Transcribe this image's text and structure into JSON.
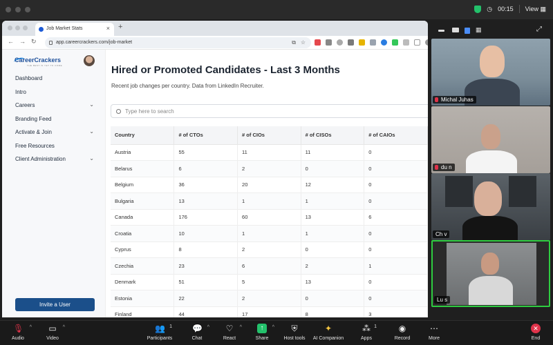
{
  "meeting": {
    "timer": "00:15",
    "view_label": "View"
  },
  "browser": {
    "tab_title": "Job Market Stats",
    "url": "app.careercrackers.com/job-market"
  },
  "sidebar": {
    "logo_text": "CareerCrackers",
    "logo_tagline": "THE BEST IS YET TO COME",
    "items": [
      {
        "label": "Dashboard"
      },
      {
        "label": "Intro"
      },
      {
        "label": "Careers"
      },
      {
        "label": "Branding Feed"
      },
      {
        "label": "Activate & Join"
      },
      {
        "label": "Free Resources"
      },
      {
        "label": "Client Administration"
      }
    ],
    "invite_label": "Invite a User"
  },
  "main": {
    "title": "Hired or Promoted Candidates - Last 3 Months",
    "subtitle": "Recent job changes per country. Data from LinkedIn Recruiter.",
    "search_placeholder": "Type here to search",
    "table": {
      "headers": [
        "Country",
        "# of CTOs",
        "# of CIOs",
        "# of CISOs",
        "# of CAIOs"
      ],
      "rows": [
        [
          "Austria",
          "55",
          "11",
          "11",
          "0"
        ],
        [
          "Belarus",
          "6",
          "2",
          "0",
          "0"
        ],
        [
          "Belgium",
          "36",
          "20",
          "12",
          "0"
        ],
        [
          "Bulgaria",
          "13",
          "1",
          "1",
          "0"
        ],
        [
          "Canada",
          "176",
          "60",
          "13",
          "6"
        ],
        [
          "Croatia",
          "10",
          "1",
          "1",
          "0"
        ],
        [
          "Cyprus",
          "8",
          "2",
          "0",
          "0"
        ],
        [
          "Czechia",
          "23",
          "6",
          "2",
          "1"
        ],
        [
          "Denmark",
          "51",
          "5",
          "13",
          "0"
        ],
        [
          "Estonia",
          "22",
          "2",
          "0",
          "0"
        ],
        [
          "Finland",
          "44",
          "17",
          "8",
          "3"
        ]
      ]
    }
  },
  "participants": [
    {
      "name": "Michal Juhas"
    },
    {
      "name": "du  n"
    },
    {
      "name": "Ch                          v"
    },
    {
      "name": "Lu            s"
    }
  ],
  "toolbar": {
    "buttons": [
      {
        "label": "Audio",
        "icon": "mic-muted-icon"
      },
      {
        "label": "Video",
        "icon": "video-icon"
      },
      {
        "label": "Participants",
        "icon": "participants-icon",
        "count": "1"
      },
      {
        "label": "Chat",
        "icon": "chat-icon"
      },
      {
        "label": "React",
        "icon": "heart-icon"
      },
      {
        "label": "Share",
        "icon": "share-icon"
      },
      {
        "label": "Host tools",
        "icon": "shield-icon"
      },
      {
        "label": "AI Companion",
        "icon": "sparkle-icon"
      },
      {
        "label": "Apps",
        "icon": "apps-icon",
        "count": "1"
      },
      {
        "label": "Record",
        "icon": "record-icon"
      },
      {
        "label": "More",
        "icon": "more-icon"
      },
      {
        "label": "End",
        "icon": "end-icon"
      }
    ]
  }
}
